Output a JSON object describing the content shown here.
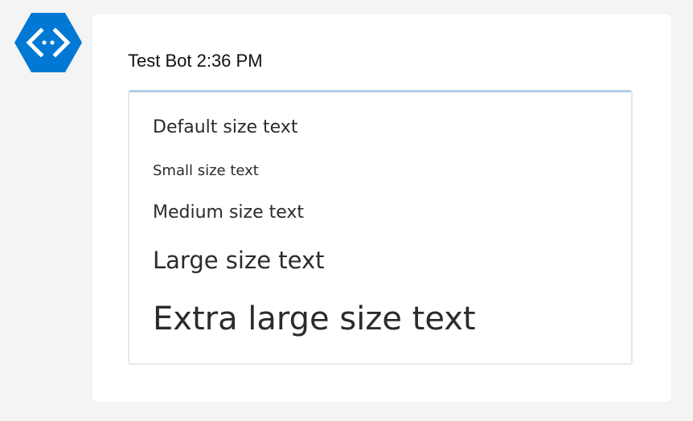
{
  "bot": {
    "avatar_icon": "bot-code-hexagon-icon",
    "accent_color": "#0078d4"
  },
  "message": {
    "sender": "Test Bot",
    "time": "2:36 PM",
    "sender_line": "Test Bot 2:36 PM"
  },
  "card": {
    "accent_border_color": "#b3cde6",
    "lines": {
      "default": "Default size text",
      "small": "Small size text",
      "medium": "Medium size text",
      "large": "Large size text",
      "extra_large": "Extra large size text"
    }
  }
}
